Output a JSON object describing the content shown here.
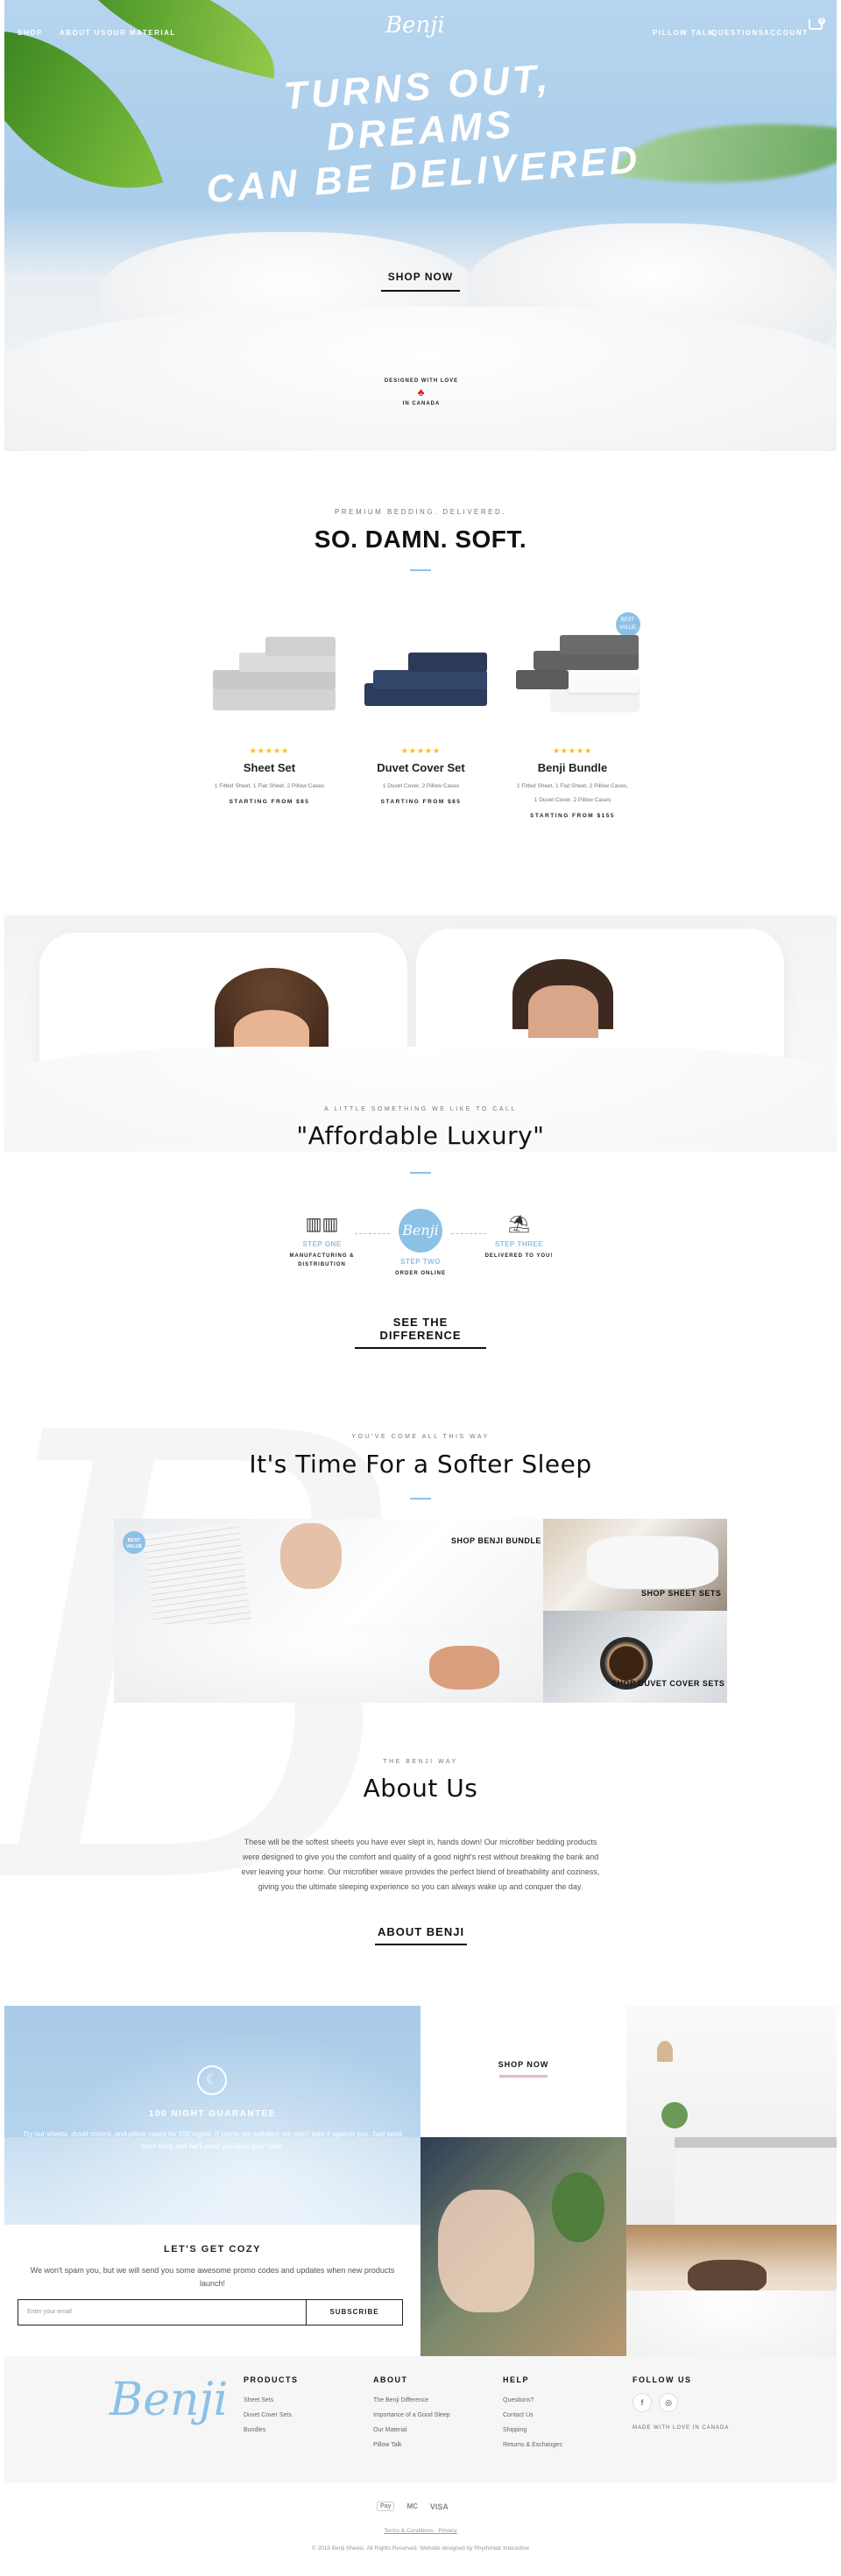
{
  "nav": {
    "left": [
      "SHOP",
      "ABOUT US",
      "OUR MATERIAL"
    ],
    "logo": "Benji",
    "right": [
      "PILLOW TALK",
      "QUESTIONS",
      "ACCOUNT"
    ],
    "cart_count": "0",
    "cart_icon": "cart-icon"
  },
  "hero": {
    "title_line1": "TURNS OUT, DREAMS",
    "title_line2": "CAN BE DELIVERED",
    "cta": "SHOP NOW",
    "badge_top": "DESIGNED WITH LOVE",
    "badge_bottom": "IN CANADA",
    "badge_icon": "maple-leaf-icon"
  },
  "products_section": {
    "eyebrow": "PREMIUM BEDDING. DELIVERED.",
    "title": "SO. DAMN. SOFT.",
    "items": [
      {
        "name": "Sheet Set",
        "desc": "1 Fitted Sheet, 1 Flat Sheet, 2 Pillow Cases",
        "price": "STARTING FROM $85",
        "stars": "★★★★★",
        "color": "#d6d6d4"
      },
      {
        "name": "Duvet Cover Set",
        "desc": "1 Duvet Cover, 2 Pillow Cases",
        "price": "STARTING FROM $85",
        "stars": "★★★★★",
        "color": "#2c3e5f"
      },
      {
        "name": "Benji Bundle",
        "desc": "1 Fitted Sheet, 1 Flat Sheet, 2 Pillow Cases, 1 Duvet Cover, 2 Pillow Cases",
        "price": "STARTING FROM $155",
        "stars": "★★★★★",
        "color": "#5b5c5e",
        "badge": "BEST VALUE"
      }
    ]
  },
  "luxury": {
    "eyebrow": "A LITTLE SOMETHING WE LIKE TO CALL",
    "title": "\"Affordable Luxury\"",
    "steps": [
      {
        "label": "STEP ONE",
        "sub": "MANUFACTURING & DISTRIBUTION",
        "icon": "factory-icon"
      },
      {
        "label": "STEP TWO",
        "sub": "ORDER ONLINE",
        "icon": "benji-logo-icon",
        "logo": "Benji"
      },
      {
        "label": "STEP THREE",
        "sub": "DELIVERED TO YOU!",
        "icon": "parachute-box-icon"
      }
    ],
    "cta": "SEE THE DIFFERENCE"
  },
  "softer": {
    "eyebrow": "YOU'VE COME ALL THIS WAY",
    "title": "It's Time For a Softer Sleep",
    "badge": "BEST VALUE",
    "tiles": {
      "bundle": "SHOP BENJI BUNDLE",
      "sheets": "SHOP SHEET SETS",
      "duvet": "SHOP DUVET COVER SETS"
    }
  },
  "about": {
    "eyebrow": "THE BENJI WAY",
    "title": "About Us",
    "text": "These will be the softest sheets you have ever slept in, hands down! Our microfiber bedding products were designed to give you the comfort and quality of a good night's rest without breaking the bank and ever leaving your home. Our microfiber weave provides the perfect blend of breathability and coziness, giving you the ultimate sleeping experience so you can always wake up and conquer the day.",
    "cta": "ABOUT BENJI"
  },
  "guarantee": {
    "title": "100 NIGHT GUARANTEE",
    "text": "Try our sheets, duvet covers, and pillow cases for 100 nights. If you're not satisfied, we won't take it against you. Just send them back and we'll send you back your cash.",
    "icon": "moon-icon"
  },
  "newsletter": {
    "title": "LET'S GET COZY",
    "text": "We won't spam you, but we will send you some awesome promo codes and updates when new products launch!",
    "placeholder": "Enter your email",
    "button": "SUBSCRIBE"
  },
  "gallery": {
    "cta": "SHOP NOW"
  },
  "footer": {
    "logo": "Benji",
    "columns": [
      {
        "title": "PRODUCTS",
        "links": [
          "Sheet Sets",
          "Duvet Cover Sets",
          "Bundles"
        ]
      },
      {
        "title": "ABOUT",
        "links": [
          "The Benji Difference",
          "Importance of a Good Sleep",
          "Our Material",
          "Pillow Talk"
        ]
      },
      {
        "title": "HELP",
        "links": [
          "Questions?",
          "Contact Us",
          "Shipping",
          "Returns & Exchanges"
        ]
      }
    ],
    "follow_title": "FOLLOW US",
    "social": [
      "f",
      "◎"
    ],
    "made": "MADE WITH LOVE IN CANADA",
    "payments": [
      "Pay",
      "MC",
      "VISA"
    ],
    "legal_links": "Terms & Conditions   ·   Privacy",
    "copyright": "© 2018 Benji Sheets. All Rights Reserved. Website designed by Rhythmlab Interactive"
  }
}
